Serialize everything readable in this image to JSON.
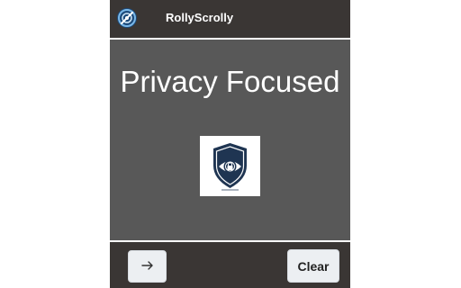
{
  "header": {
    "logo_icon": "rollyscrolly-logo-icon",
    "title": "RollyScrolly"
  },
  "slide": {
    "title": "Privacy Focused",
    "image_icon": "shield-eye-lock-icon"
  },
  "footer": {
    "next_icon": "arrow-right-icon",
    "clear_label": "Clear"
  },
  "colors": {
    "header_background": "#3a3634",
    "content_background": "#585858",
    "button_background": "#eceff2",
    "shield_navy": "#1f3552"
  }
}
